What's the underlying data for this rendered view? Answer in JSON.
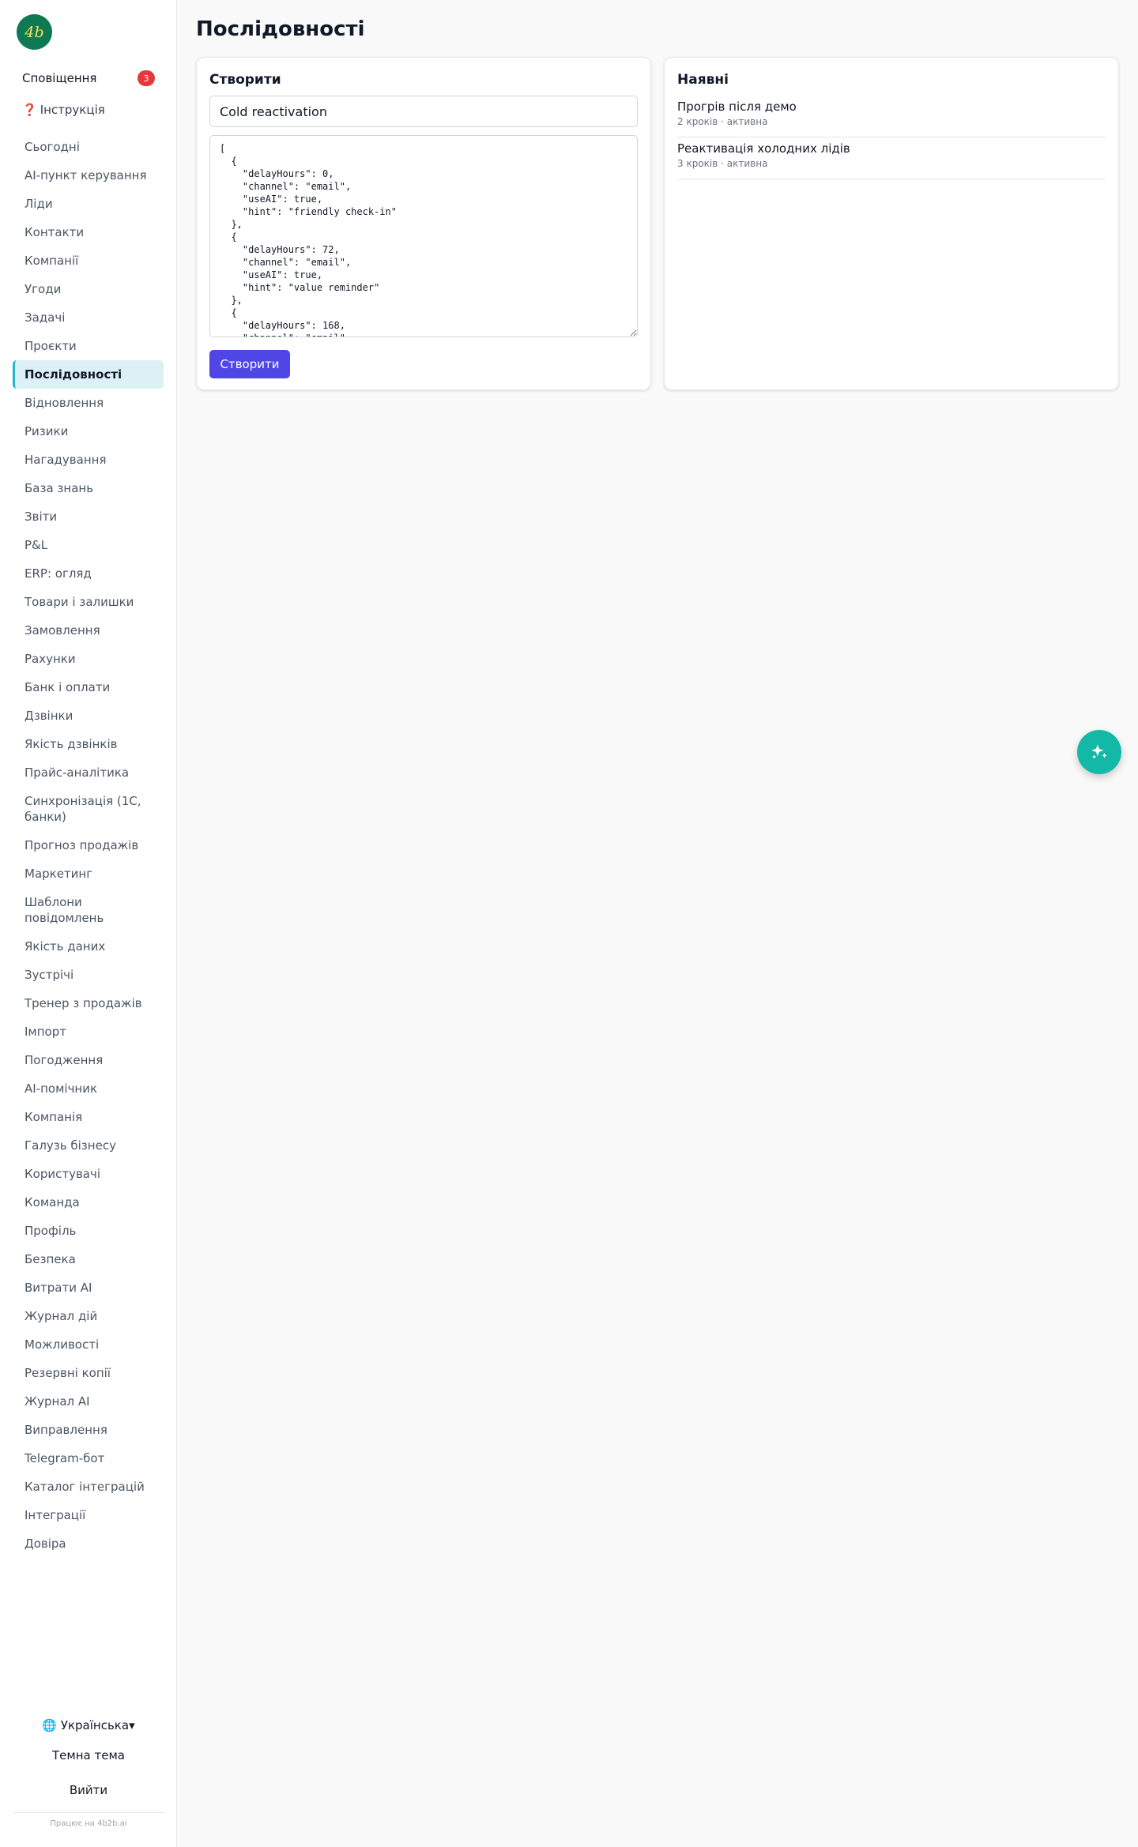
{
  "brand": {
    "logo_text": "4b"
  },
  "sidebar": {
    "notifications_label": "Сповіщення",
    "notifications_count": "3",
    "guide_icon": "❓",
    "guide_label": "Інструкція",
    "items": [
      {
        "label": "Сьогодні"
      },
      {
        "label": "AI-пункт керування"
      },
      {
        "label": "Ліди"
      },
      {
        "label": "Контакти"
      },
      {
        "label": "Компанії"
      },
      {
        "label": "Угоди"
      },
      {
        "label": "Задачі"
      },
      {
        "label": "Проєкти"
      },
      {
        "label": "Послідовності",
        "active": true
      },
      {
        "label": "Відновлення"
      },
      {
        "label": "Ризики"
      },
      {
        "label": "Нагадування"
      },
      {
        "label": "База знань"
      },
      {
        "label": "Звіти"
      },
      {
        "label": "P&L"
      },
      {
        "label": "ERP: огляд"
      },
      {
        "label": "Товари і залишки"
      },
      {
        "label": "Замовлення"
      },
      {
        "label": "Рахунки"
      },
      {
        "label": "Банк і оплати"
      },
      {
        "label": "Дзвінки"
      },
      {
        "label": "Якість дзвінків"
      },
      {
        "label": "Прайс-аналітика"
      },
      {
        "label": "Синхронізація (1С, банки)"
      },
      {
        "label": "Прогноз продажів"
      },
      {
        "label": "Маркетинг"
      },
      {
        "label": "Шаблони повідомлень"
      },
      {
        "label": "Якість даних"
      },
      {
        "label": "Зустрічі"
      },
      {
        "label": "Тренер з продажів"
      },
      {
        "label": "Імпорт"
      },
      {
        "label": "Погодження"
      },
      {
        "label": "AI-помічник"
      },
      {
        "label": "Компанія"
      },
      {
        "label": "Галузь бізнесу"
      },
      {
        "label": "Користувачі"
      },
      {
        "label": "Команда"
      },
      {
        "label": "Профіль"
      },
      {
        "label": "Безпека"
      },
      {
        "label": "Витрати AI"
      },
      {
        "label": "Журнал дій"
      },
      {
        "label": "Можливості"
      },
      {
        "label": "Резервні копії"
      },
      {
        "label": "Журнал AI"
      },
      {
        "label": "Виправлення"
      },
      {
        "label": "Telegram-бот"
      },
      {
        "label": "Каталог інтеграцій"
      },
      {
        "label": "Інтеграції"
      },
      {
        "label": "Довіра"
      }
    ],
    "language_label": "🌐 Українська▾",
    "theme_label": "Темна тема",
    "logout_label": "Вийти",
    "powered_by": "Працює на 4b2b.ai"
  },
  "main": {
    "title": "Послідовності",
    "create": {
      "title": "Створити",
      "name_value": "Cold reactivation",
      "steps_json": "[\n  {\n    \"delayHours\": 0,\n    \"channel\": \"email\",\n    \"useAI\": true,\n    \"hint\": \"friendly check-in\"\n  },\n  {\n    \"delayHours\": 72,\n    \"channel\": \"email\",\n    \"useAI\": true,\n    \"hint\": \"value reminder\"\n  },\n  {\n    \"delayHours\": 168,\n    \"channel\": \"email\",",
      "button_label": "Створити"
    },
    "existing": {
      "title": "Наявні",
      "items": [
        {
          "name": "Прогрів після демо",
          "meta": "2 кроків · активна"
        },
        {
          "name": "Реактивація холодних лідів",
          "meta": "3 кроків · активна"
        }
      ]
    }
  },
  "fab": {
    "icon": "sparkles-icon",
    "color": "#14b8a6"
  },
  "colors": {
    "accent": "#4f46e5",
    "active_bg": "#dcf1f6",
    "active_border": "#22b5cf",
    "badge": "#e23a3a",
    "logo_bg": "#0f7a52"
  }
}
